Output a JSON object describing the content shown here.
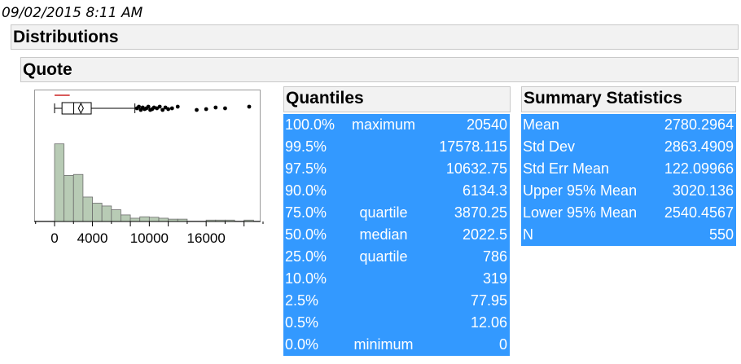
{
  "timestamp": "09/02/2015 8:11 AM",
  "report": {
    "title": "Distributions",
    "variable": "Quote"
  },
  "chart_data": {
    "type": "bar",
    "subtype": "histogram-with-boxplot",
    "x_ticks": [
      "0",
      "4000",
      "10000",
      "16000"
    ],
    "xlim": [
      -2000,
      22000
    ],
    "bin_width": 1000,
    "bins": [
      {
        "x0": 0,
        "x1": 1000,
        "count": 165
      },
      {
        "x0": 1000,
        "x1": 2000,
        "count": 98
      },
      {
        "x0": 2000,
        "x1": 3000,
        "count": 100
      },
      {
        "x0": 3000,
        "x1": 4000,
        "count": 52
      },
      {
        "x0": 4000,
        "x1": 5000,
        "count": 39
      },
      {
        "x0": 5000,
        "x1": 6000,
        "count": 33
      },
      {
        "x0": 6000,
        "x1": 7000,
        "count": 25
      },
      {
        "x0": 7000,
        "x1": 8000,
        "count": 14
      },
      {
        "x0": 8000,
        "x1": 9000,
        "count": 7
      },
      {
        "x0": 9000,
        "x1": 10000,
        "count": 10
      },
      {
        "x0": 10000,
        "x1": 11000,
        "count": 9
      },
      {
        "x0": 11000,
        "x1": 12000,
        "count": 7
      },
      {
        "x0": 12000,
        "x1": 13000,
        "count": 5
      },
      {
        "x0": 13000,
        "x1": 14000,
        "count": 5
      },
      {
        "x0": 16000,
        "x1": 17000,
        "count": 3
      },
      {
        "x0": 17000,
        "x1": 18000,
        "count": 3
      },
      {
        "x0": 18000,
        "x1": 19000,
        "count": 3
      },
      {
        "x0": 20000,
        "x1": 21000,
        "count": 3
      }
    ],
    "ylim": [
      0,
      180
    ],
    "boxplot": {
      "min": 0,
      "q1": 786,
      "median": 2022.5,
      "q3": 3870.25,
      "max_whisker": 8480,
      "mean": 2780.2964,
      "shortest_half": [
        0,
        1600
      ],
      "outliers": [
        8700,
        8900,
        9100,
        9300,
        9500,
        9700,
        9900,
        10100,
        10300,
        10500,
        10800,
        11100,
        11400,
        11700,
        12000,
        12400,
        13000,
        15000,
        16000,
        17000,
        18000,
        20540
      ]
    },
    "colors": {
      "bars": "#b8cbb5",
      "bar_stroke": "#6e6e6e",
      "shortest_half": "#cc2222"
    }
  },
  "quantiles": {
    "title": "Quantiles",
    "rows": [
      {
        "pct": "100.0%",
        "label": "maximum",
        "value": "20540"
      },
      {
        "pct": "99.5%",
        "label": "",
        "value": "17578.115"
      },
      {
        "pct": "97.5%",
        "label": "",
        "value": "10632.75"
      },
      {
        "pct": "90.0%",
        "label": "",
        "value": "6134.3"
      },
      {
        "pct": "75.0%",
        "label": "quartile",
        "value": "3870.25"
      },
      {
        "pct": "50.0%",
        "label": "median",
        "value": "2022.5"
      },
      {
        "pct": "25.0%",
        "label": "quartile",
        "value": "786"
      },
      {
        "pct": "10.0%",
        "label": "",
        "value": "319"
      },
      {
        "pct": "2.5%",
        "label": "",
        "value": "77.95"
      },
      {
        "pct": "0.5%",
        "label": "",
        "value": "12.06"
      },
      {
        "pct": "0.0%",
        "label": "minimum",
        "value": "0"
      }
    ]
  },
  "summary": {
    "title": "Summary Statistics",
    "rows": [
      {
        "label": "Mean",
        "value": "2780.2964"
      },
      {
        "label": "Std Dev",
        "value": "2863.4909"
      },
      {
        "label": "Std Err Mean",
        "value": "122.09966"
      },
      {
        "label": "Upper 95% Mean",
        "value": "3020.136"
      },
      {
        "label": "Lower 95% Mean",
        "value": "2540.4567"
      },
      {
        "label": "N",
        "value": "550"
      }
    ]
  },
  "colors": {
    "selection": "#3399ff",
    "header_bg": "#f2f2f2"
  }
}
